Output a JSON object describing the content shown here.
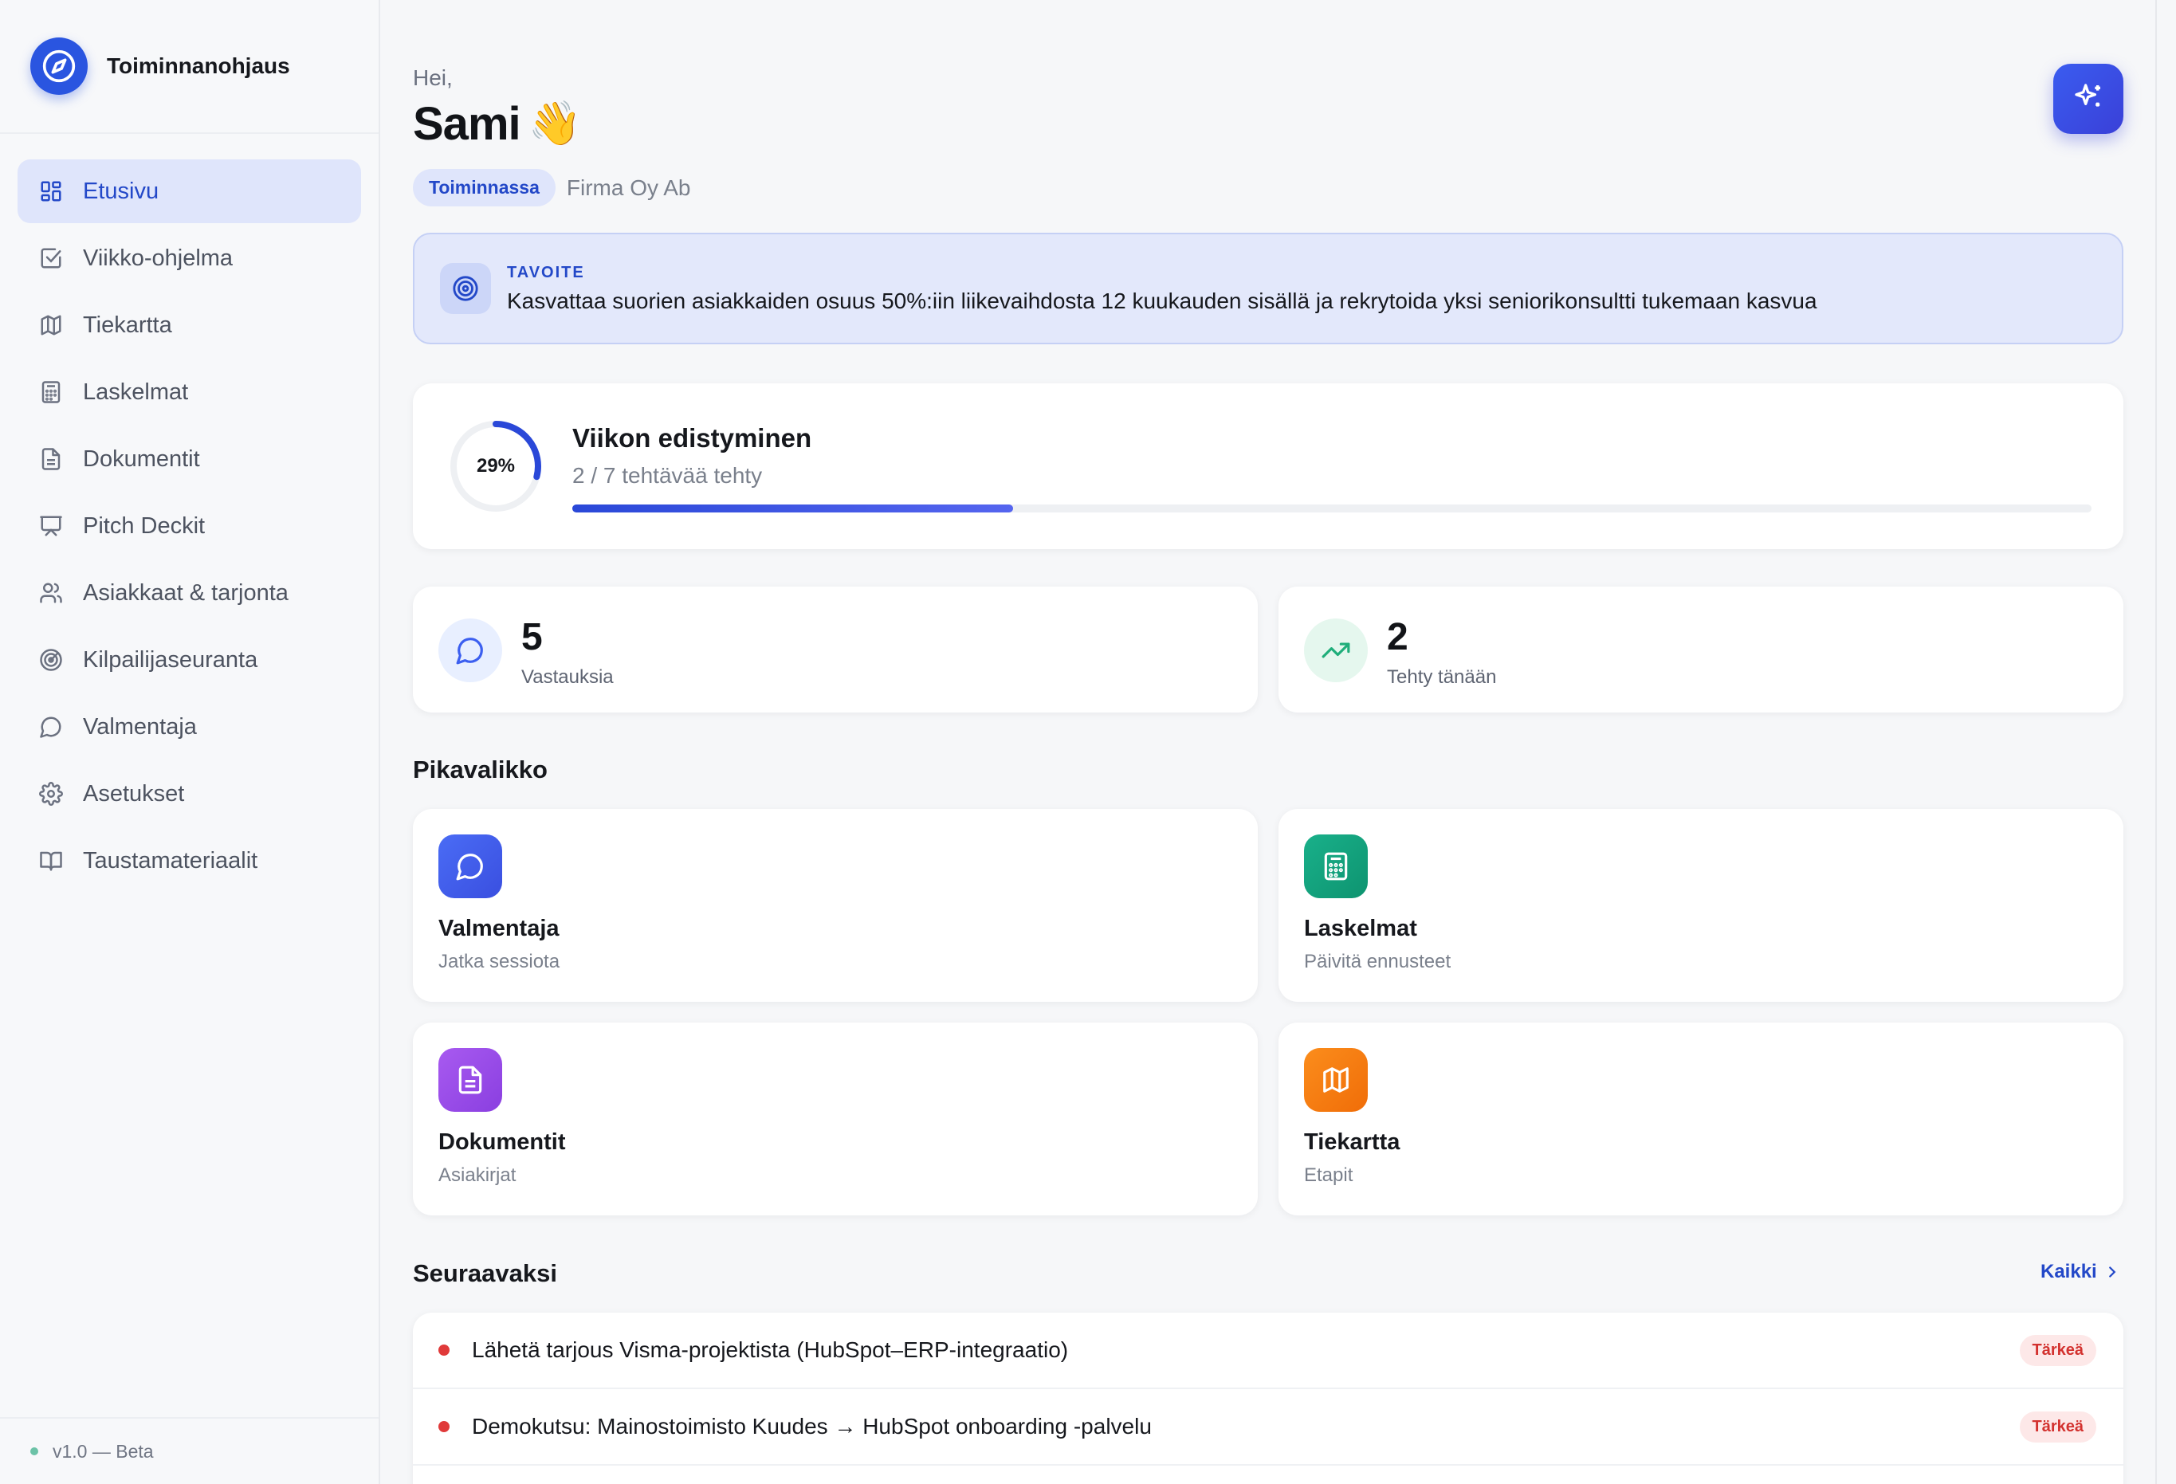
{
  "app": {
    "name": "Toiminnanohjaus",
    "version": "v1.0 — Beta"
  },
  "sidebar": {
    "items": [
      {
        "label": "Etusivu",
        "icon": "grid-icon",
        "active": true
      },
      {
        "label": "Viikko-ohjelma",
        "icon": "checkbox-icon"
      },
      {
        "label": "Tiekartta",
        "icon": "map-icon"
      },
      {
        "label": "Laskelmat",
        "icon": "calculator-icon"
      },
      {
        "label": "Dokumentit",
        "icon": "document-icon"
      },
      {
        "label": "Pitch Deckit",
        "icon": "presentation-icon"
      },
      {
        "label": "Asiakkaat & tarjonta",
        "icon": "users-icon"
      },
      {
        "label": "Kilpailijaseuranta",
        "icon": "radar-icon"
      },
      {
        "label": "Valmentaja",
        "icon": "chat-icon"
      },
      {
        "label": "Asetukset",
        "icon": "gear-icon"
      },
      {
        "label": "Taustamateriaalit",
        "icon": "book-icon"
      }
    ]
  },
  "header": {
    "greeting": "Hei,",
    "name": "Sami",
    "emoji": "👋",
    "status": "Toiminnassa",
    "company": "Firma Oy Ab"
  },
  "goal": {
    "label": "TAVOITE",
    "text": "Kasvattaa suorien asiakkaiden osuus 50%:iin liikevaihdosta 12 kuukauden sisällä ja rekrytoida yksi seniorikonsultti tukemaan kasvua"
  },
  "progress": {
    "percent_label": "29%",
    "fraction": 0.29,
    "title": "Viikon edistyminen",
    "subtitle": "2 / 7 tehtävää tehty"
  },
  "stats": [
    {
      "value": "5",
      "label": "Vastauksia",
      "icon": "chat-icon"
    },
    {
      "value": "2",
      "label": "Tehty tänään",
      "icon": "trending-up-icon"
    }
  ],
  "quick": {
    "title": "Pikavalikko",
    "items": [
      {
        "title": "Valmentaja",
        "subtitle": "Jatka sessiota",
        "icon": "chat-icon",
        "color": "#3c5ff0"
      },
      {
        "title": "Laskelmat",
        "subtitle": "Päivitä ennusteet",
        "icon": "calculator-icon",
        "color": "#12a37e"
      },
      {
        "title": "Dokumentit",
        "subtitle": "Asiakirjat",
        "icon": "document-icon",
        "color": "#9b4de8"
      },
      {
        "title": "Tiekartta",
        "subtitle": "Etapit",
        "icon": "map-icon",
        "color": "#f57c0f"
      }
    ]
  },
  "next": {
    "title": "Seuraavaksi",
    "all_label": "Kaikki",
    "tasks": [
      {
        "text": "Lähetä tarjous Visma-projektista (HubSpot–ERP-integraatio)",
        "badge": "Tärkeä"
      },
      {
        "text": "Demokutsu: Mainostoimisto Kuudes → HubSpot onboarding -palvelu",
        "badge": "Tärkeä"
      }
    ]
  },
  "colors": {
    "accent": "#2348c8",
    "danger": "#e03a3a",
    "success": "#1fae7a"
  }
}
